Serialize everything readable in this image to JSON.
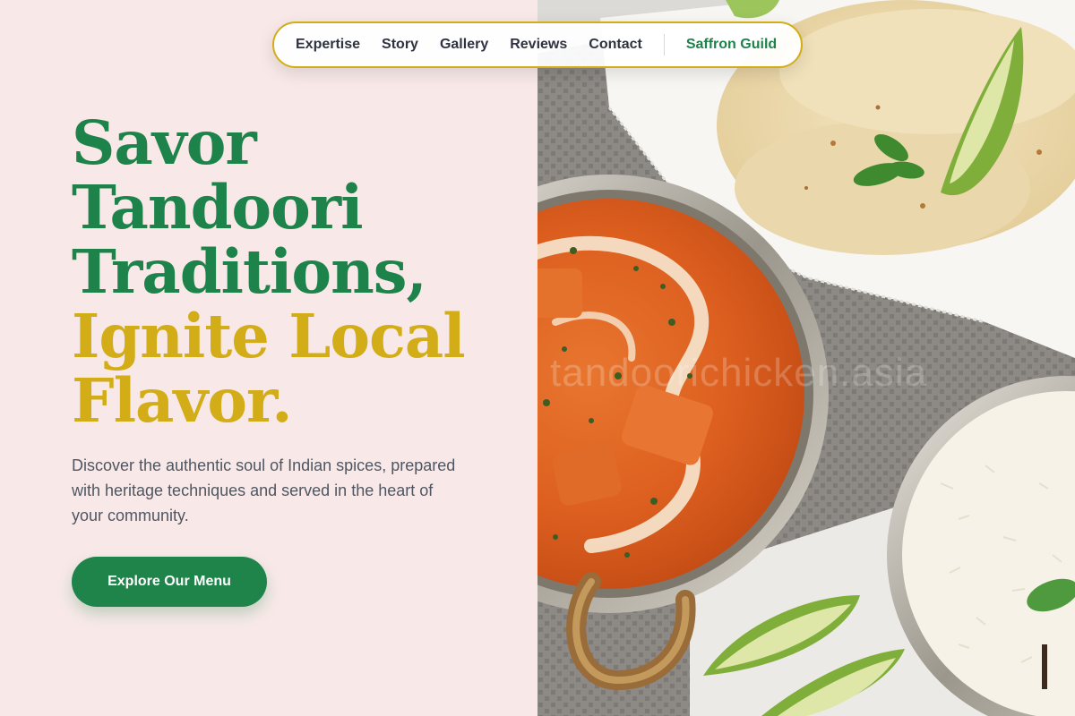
{
  "nav": {
    "links": [
      "Expertise",
      "Story",
      "Gallery",
      "Reviews",
      "Contact"
    ],
    "brand": "Saffron Guild"
  },
  "hero": {
    "title_lines_green": [
      "Savor",
      "Tandoori",
      "Traditions,"
    ],
    "title_lines_gold": [
      "Ignite Local",
      "Flavor."
    ],
    "description": "Discover the authentic soul of Indian spices, prepared with heritage techniques and served in the heart of your community.",
    "cta_label": "Explore Our Menu"
  },
  "photo": {
    "watermark": "tandoorichicken.asia",
    "subjects": [
      "curry-bowl",
      "naan-bread",
      "lime-wedges",
      "rice-bowl",
      "mint-leaves",
      "grey-napkin"
    ]
  },
  "colors": {
    "brand_green": "#1e834a",
    "accent_gold": "#d2ad17",
    "page_background": "#f8e9e8",
    "body_text": "#4f5661"
  }
}
